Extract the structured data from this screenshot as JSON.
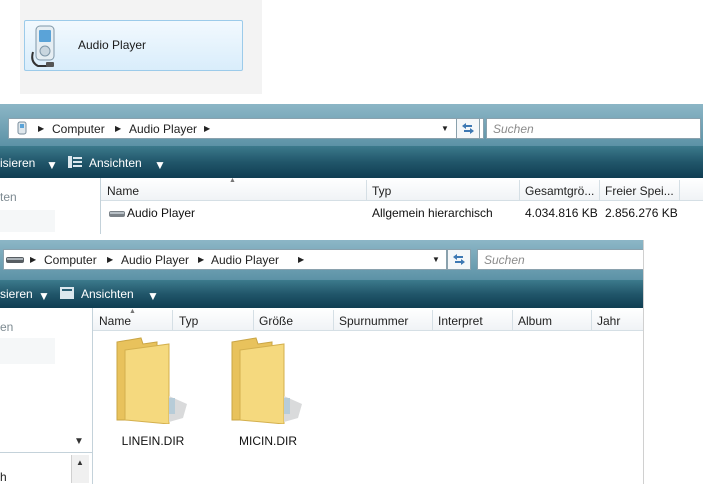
{
  "tile": {
    "label": "Audio Player",
    "icon": "media-player-icon"
  },
  "window1": {
    "breadcrumb": [
      "Computer",
      "Audio Player"
    ],
    "search_placeholder": "Suchen",
    "toolbar": {
      "organize": "isieren",
      "views": "Ansichten"
    },
    "nav_text": "ten",
    "columns": [
      "Name",
      "Typ",
      "Gesamtgrö...",
      "Freier Spei..."
    ],
    "row": {
      "name": "Audio Player",
      "type": "Allgemein hierarchisch",
      "total": "4.034.816 KB",
      "free": "2.856.276 KB"
    }
  },
  "window2": {
    "breadcrumb": [
      "Computer",
      "Audio Player",
      "Audio Player"
    ],
    "search_placeholder": "Suchen",
    "toolbar": {
      "organize": "sieren",
      "views": "Ansichten"
    },
    "nav_text": "en",
    "nav_bottom": "h",
    "columns": [
      "Name",
      "Typ",
      "Größe",
      "Spurnummer",
      "Interpret",
      "Album",
      "Jahr"
    ],
    "folders": [
      {
        "name": "LINEIN.DIR",
        "icon": "folder-icon"
      },
      {
        "name": "MICIN.DIR",
        "icon": "folder-icon"
      }
    ]
  },
  "colors": {
    "toolbar": "#21566a",
    "tile_bg": "#d9edfb",
    "folder": "#f2d479"
  }
}
